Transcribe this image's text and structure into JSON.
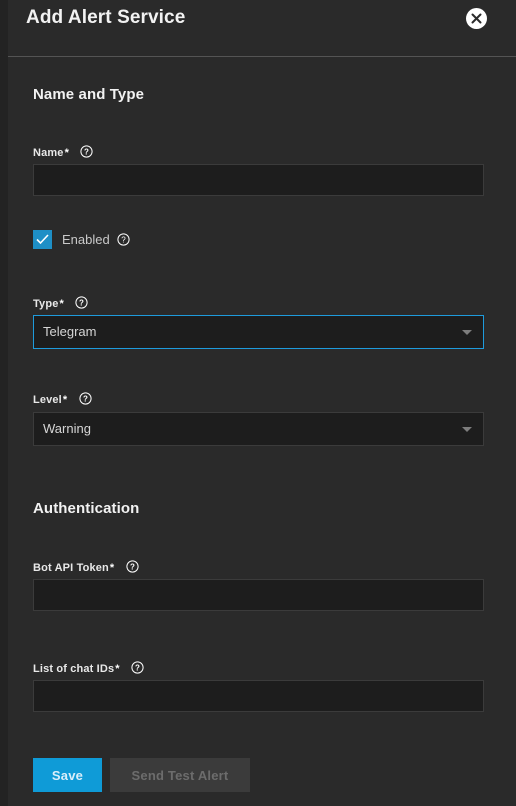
{
  "header": {
    "title": "Add Alert Service",
    "close_icon": "close-icon"
  },
  "sections": {
    "name_and_type": {
      "title": "Name and Type",
      "name_field": {
        "label": "Name",
        "required_mark": "*",
        "value": "",
        "placeholder": "",
        "help_icon": "help-icon"
      },
      "enabled_checkbox": {
        "label": "Enabled",
        "checked": true,
        "help_icon": "help-icon"
      },
      "type_field": {
        "label": "Type",
        "required_mark": "*",
        "value": "Telegram",
        "focused": true,
        "help_icon": "help-icon",
        "arrow_icon": "chevron-down-icon"
      },
      "level_field": {
        "label": "Level",
        "required_mark": "*",
        "value": "Warning",
        "focused": false,
        "help_icon": "help-icon",
        "arrow_icon": "chevron-down-icon"
      }
    },
    "authentication": {
      "title": "Authentication",
      "bot_api_token": {
        "label": "Bot API Token",
        "required_mark": "*",
        "value": "",
        "placeholder": "",
        "help_icon": "help-icon"
      },
      "chat_ids": {
        "label": "List of chat IDs",
        "required_mark": "*",
        "value": "",
        "placeholder": "",
        "help_icon": "help-icon"
      }
    }
  },
  "footer": {
    "save_label": "Save",
    "send_test_label": "Send Test Alert"
  },
  "colors": {
    "accent": "#0f9bd7",
    "focus_border": "#1e9bdc",
    "panel_bg": "#2a2a2a",
    "input_bg": "#1d1d1d",
    "disabled_btn": "#3b3b3b"
  }
}
